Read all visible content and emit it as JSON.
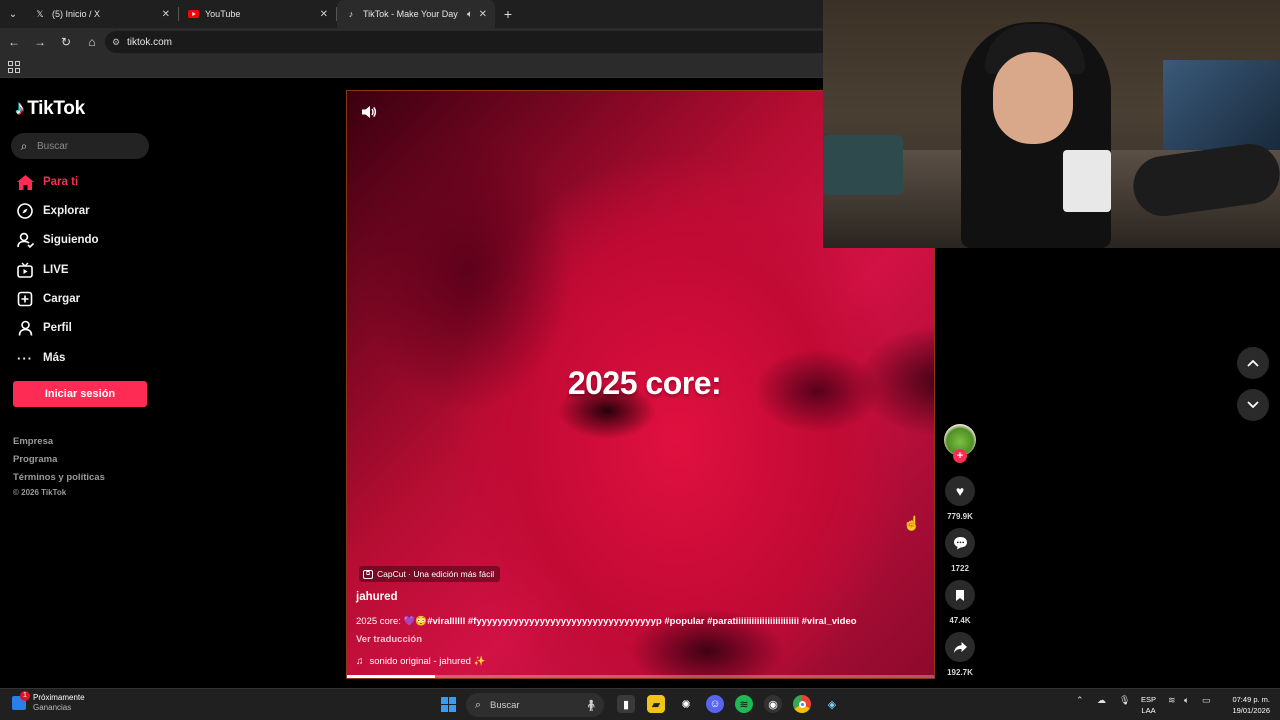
{
  "browser": {
    "tabs": [
      {
        "title": "(5) Inicio / X",
        "icon": "x-logo-icon",
        "active": false
      },
      {
        "title": "YouTube",
        "icon": "youtube-icon",
        "active": false
      },
      {
        "title": "TikTok - Make Your Day",
        "icon": "tiktok-icon",
        "active": true,
        "muted": true
      }
    ],
    "url": "tiktok.com"
  },
  "sidebar": {
    "brand": "TikTok",
    "search_placeholder": "Buscar",
    "nav": [
      {
        "label": "Para ti",
        "icon": "home-icon",
        "active": true
      },
      {
        "label": "Explorar",
        "icon": "compass-icon"
      },
      {
        "label": "Siguiendo",
        "icon": "following-icon"
      },
      {
        "label": "LIVE",
        "icon": "live-tv-icon"
      },
      {
        "label": "Cargar",
        "icon": "upload-icon"
      },
      {
        "label": "Perfil",
        "icon": "person-icon"
      },
      {
        "label": "Más",
        "icon": "more-icon"
      }
    ],
    "login_label": "Iniciar sesión",
    "footer_links": [
      "Empresa",
      "Programa",
      "Términos y políticas"
    ],
    "copyright": "© 2026 TikTok"
  },
  "video": {
    "overlay_text": "2025 core:",
    "capcut_label": "CapCut · Una edición más fácil",
    "author": "jahured",
    "caption_prefix": "2025 core: 💜😳",
    "caption_tags": "#virallllll #fyyyyyyyyyyyyyyyyyyyyyyyyyyyyyyyyyyp #popular #paratiiiiiiiiiiiiiiiiiiiiiiii #viral_video",
    "translate_label": "Ver traducción",
    "sound": "sonido original - jahured ✨",
    "progress": 0.15
  },
  "actions": {
    "likes": "779.9K",
    "comments": "1722",
    "saves": "47.4K",
    "shares": "192.7K"
  },
  "taskbar": {
    "widget_title": "Próximamente",
    "widget_sub": "Ganancias",
    "widget_badge": "1",
    "search_placeholder": "Buscar",
    "lang_line1": "ESP",
    "lang_line2": "LAA",
    "time": "07:49 p. m.",
    "date": "19/01/2026"
  },
  "colors": {
    "accent": "#fe2c55",
    "video_tint": "#c20a35"
  }
}
